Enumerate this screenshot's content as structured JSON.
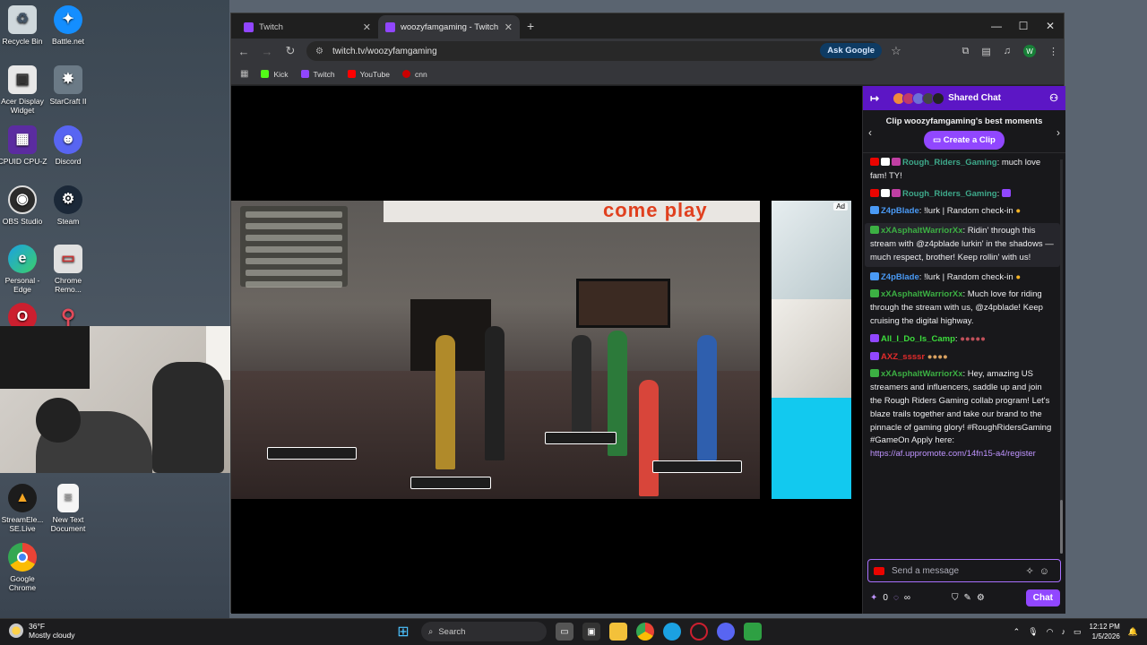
{
  "desktop": {
    "icons": [
      {
        "label": "Recycle Bin",
        "icon": "recycle-bin-icon",
        "color": "#cfd8dc"
      },
      {
        "label": "Battle.net",
        "icon": "battlenet-icon",
        "color": "#148eff"
      },
      {
        "label": "Acer Display Widget",
        "icon": "acer-icon",
        "color": "#e8e8e8"
      },
      {
        "label": "StarCraft II",
        "icon": "starcraft-icon",
        "color": "#6b7a86"
      },
      {
        "label": "CPUID CPU-Z",
        "icon": "cpuz-icon",
        "color": "#5b2ca0"
      },
      {
        "label": "Discord",
        "icon": "discord-icon",
        "color": "#5865f2"
      },
      {
        "label": "OBS Studio",
        "icon": "obs-icon",
        "color": "#2b2b2b"
      },
      {
        "label": "Steam",
        "icon": "steam-icon",
        "color": "#1b2838"
      },
      {
        "label": "Personal - Edge",
        "icon": "edge-icon",
        "color": "#1ba1e2"
      },
      {
        "label": "Chrome Remo...",
        "icon": "chrome-remote-icon",
        "color": "#e0e0e0"
      },
      {
        "label": "StreamEle... SE.Live",
        "icon": "streamelements-icon",
        "color": "#1c1c1c"
      },
      {
        "label": "New Text Document",
        "icon": "text-doc-icon",
        "color": "#f5f5f5"
      },
      {
        "label": "Google Chrome",
        "icon": "chrome-icon",
        "color": "#ffffff"
      }
    ]
  },
  "browser": {
    "tabs": [
      {
        "label": "Twitch",
        "active": false
      },
      {
        "label": "woozyfamgaming - Twitch",
        "active": true
      }
    ],
    "url": "twitch.tv/woozyfamgaming",
    "ask_google": "Ask Google",
    "profile_initial": "W",
    "bookmarks": [
      {
        "label": "Kick",
        "color": "#53fc18"
      },
      {
        "label": "Twitch",
        "color": "#9146ff"
      },
      {
        "label": "YouTube",
        "color": "#ff0000"
      },
      {
        "label": "cnn",
        "color": "#cc0000"
      }
    ]
  },
  "stream": {
    "ad_label": "Ad",
    "game_banner": "come play"
  },
  "chat": {
    "header": "Shared Chat",
    "clip_title": "Clip woozyfamgaming's best moments",
    "clip_button": "Create a Clip",
    "messages": [
      {
        "user": "Rough_Riders_Gaming",
        "color": "#3ea88a",
        "text": ": much love fam! TY!"
      },
      {
        "user": "Rough_Riders_Gaming",
        "color": "#3ea88a",
        "text": ":"
      },
      {
        "user": "Z4pBlade",
        "color": "#4a9af5",
        "text": ": !lurk | Random check-in"
      },
      {
        "user": "xXAsphaltWarriorXx",
        "color": "#3cb043",
        "text": ": Ridin' through this stream with @z4pblade lurkin' in the shadows — much respect, brother! Keep rollin' with us!"
      },
      {
        "user": "Z4pBlade",
        "color": "#4a9af5",
        "text": ": !lurk | Random check-in"
      },
      {
        "user": "xXAsphaltWarriorXx",
        "color": "#3cb043",
        "text": ": Much love for riding through the stream with us, @z4pblade! Keep cruising the digital highway."
      },
      {
        "user": "All_I_Do_Is_Camp",
        "color": "#3cdc3c",
        "text": ":"
      },
      {
        "user": "AXZ_ssssr",
        "color": "#e22b2b",
        "text": ""
      },
      {
        "user": "xXAsphaltWarriorXx",
        "color": "#3cb043",
        "text": ": Hey, amazing US streamers and influencers, saddle up and join the Rough Riders Gaming collab program! Let's blaze trails together and take our brand to the pinnacle of gaming glory! #RoughRidersGaming #GameOn Apply here:"
      }
    ],
    "link": "https://af.uppromote.com/14fn15-a4/register",
    "input_placeholder": "Send a message",
    "points": "0",
    "send_button": "Chat"
  },
  "taskbar": {
    "temp": "36°F",
    "weather": "Mostly cloudy",
    "search": "Search",
    "time": "12:12 PM",
    "date": "1/5/2026"
  }
}
